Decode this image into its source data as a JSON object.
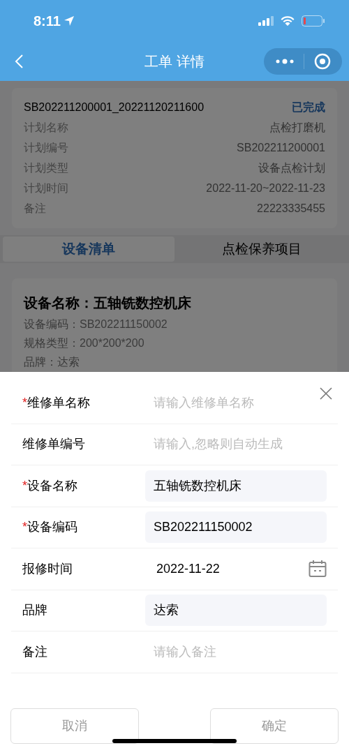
{
  "status_bar": {
    "time": "8:11"
  },
  "nav": {
    "title": "工单 详情"
  },
  "order": {
    "code": "SB202211200001_20221120211600",
    "status": "已完成",
    "fields": [
      {
        "label": "计划名称",
        "value": "点检打磨机"
      },
      {
        "label": "计划编号",
        "value": "SB202211200001"
      },
      {
        "label": "计划类型",
        "value": "设备点检计划"
      },
      {
        "label": "计划时间",
        "value": "2022-11-20~2022-11-23"
      },
      {
        "label": "备注",
        "value": "22223335455"
      }
    ]
  },
  "tabs": [
    {
      "label": "设备清单",
      "selected": true
    },
    {
      "label": "点检保养项目",
      "selected": false
    }
  ],
  "device": {
    "title": "设备名称：五轴铣数控机床",
    "lines": [
      "设备编码：SB202211150002",
      "规格类型：200*200*200",
      "品牌：达索"
    ]
  },
  "sheet": {
    "fields": [
      {
        "kind": "input",
        "required_mark": "*",
        "label": "维修单名称",
        "placeholder": "请输入维修单名称"
      },
      {
        "kind": "input",
        "label": "维修单编号",
        "placeholder": "请输入,忽略则自动生成"
      },
      {
        "kind": "readonly",
        "required_mark": "*",
        "label": "设备名称",
        "value": "五轴铣数控机床"
      },
      {
        "kind": "readonly",
        "required_mark": "*",
        "label": "设备编码",
        "value": "SB202211150002"
      },
      {
        "kind": "date",
        "label": "报修时间",
        "value": "2022-11-22"
      },
      {
        "kind": "readonly",
        "label": "品牌",
        "value": "达索"
      },
      {
        "kind": "input",
        "label": "备注",
        "placeholder": "请输入备注"
      }
    ],
    "buttons": [
      "取消",
      "确定"
    ]
  }
}
